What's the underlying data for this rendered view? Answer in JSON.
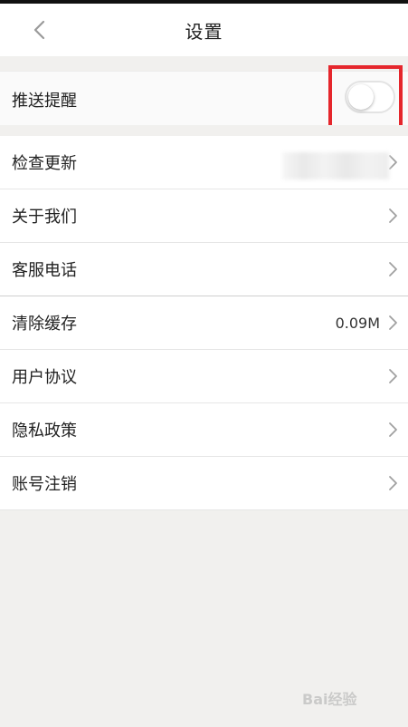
{
  "header": {
    "title": "设置"
  },
  "push": {
    "label": "推送提醒",
    "enabled": false
  },
  "rows": [
    {
      "label": "检查更新",
      "value": ""
    },
    {
      "label": "关于我们",
      "value": ""
    },
    {
      "label": "客服电话",
      "value": ""
    },
    {
      "label": "清除缓存",
      "value": "0.09M"
    },
    {
      "label": "用户协议",
      "value": ""
    },
    {
      "label": "隐私政策",
      "value": ""
    },
    {
      "label": "账号注销",
      "value": ""
    }
  ],
  "icons": {
    "back": "chevron-left-icon",
    "row": "chevron-right-icon"
  },
  "colors": {
    "highlight": "#e5262c",
    "background": "#f1f0ee"
  },
  "watermark": {
    "text": "Bai经验"
  }
}
